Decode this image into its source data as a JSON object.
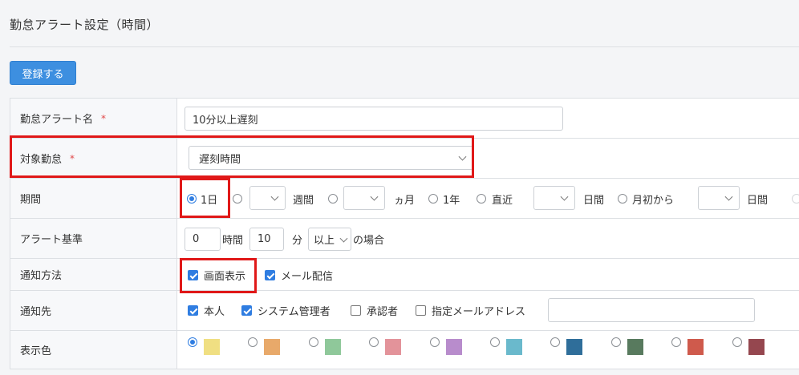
{
  "page": {
    "title": "勤怠アラート設定（時間）"
  },
  "toolbar": {
    "register_label": "登録する"
  },
  "form": {
    "alert_name": {
      "label": "勤怠アラート名",
      "required_mark": "*",
      "value": "10分以上遅刻"
    },
    "target": {
      "label": "対象勤怠",
      "required_mark": "*",
      "selected": "遅刻時間"
    },
    "period": {
      "label": "期間",
      "one_day": "1日",
      "weeks_unit": "週間",
      "months_unit": "ヵ月",
      "one_year": "1年",
      "recent": "直近",
      "recent_unit": "日間",
      "from_month_start": "月初から",
      "from_month_start_unit": "日間",
      "selected": "1日"
    },
    "criteria": {
      "label": "アラート基準",
      "hours_value": "0",
      "hours_unit": "時間",
      "minutes_value": "10",
      "minutes_unit": "分",
      "comparison": "以上",
      "suffix": "の場合"
    },
    "notify_method": {
      "label": "通知方法",
      "screen_display": "画面表示",
      "screen_display_checked": true,
      "email": "メール配信",
      "email_checked": true
    },
    "notify_to": {
      "label": "通知先",
      "self": "本人",
      "self_checked": true,
      "system_admin": "システム管理者",
      "system_admin_checked": true,
      "approver": "承認者",
      "approver_checked": false,
      "specified_email": "指定メールアドレス",
      "specified_email_checked": false,
      "email_value": ""
    },
    "display_color": {
      "label": "表示色",
      "colors": [
        "#f0df82",
        "#e8a96a",
        "#8fc89a",
        "#e3939a",
        "#b88ccc",
        "#6ab9cc",
        "#2f6e9a",
        "#587a5e",
        "#cf5a4c",
        "#95474f"
      ],
      "selected_index": 0
    }
  }
}
